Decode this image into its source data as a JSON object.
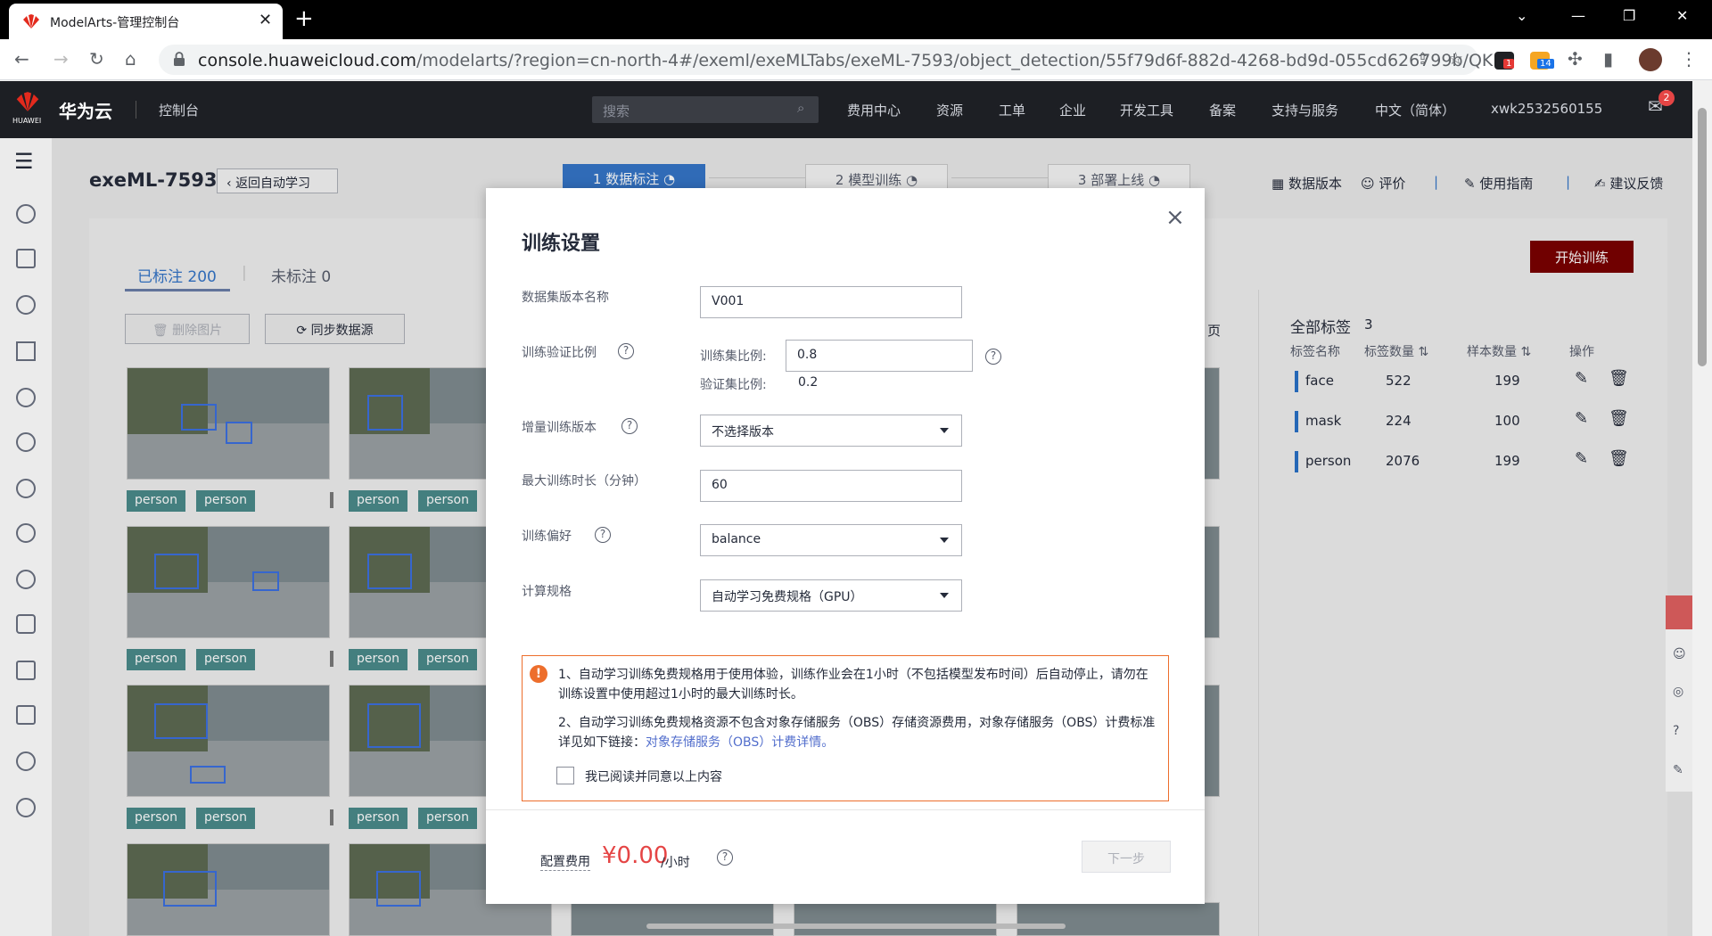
{
  "browser": {
    "tab_title": "ModelArts-管理控制台",
    "url_host": "console.huaweicloud.com",
    "url_rest": "/modelarts/?region=cn-north-4#/exeml/exeMLTabs/exeML-7593/object_detection/55f79d6f-882d-4268-bd9d-055cd626799b/QK...",
    "ext_badge_1": "1",
    "ext_badge_2": "14"
  },
  "header": {
    "brand": "华为云",
    "brand_sub": "HUAWEI",
    "console": "控制台",
    "search_placeholder": "搜索",
    "nav": [
      "费用中心",
      "资源",
      "工单",
      "企业",
      "开发工具",
      "备案",
      "支持与服务",
      "中文（简体）",
      "xwk2532560155"
    ],
    "mail_badge": "2"
  },
  "page": {
    "title": "exeML-7593",
    "back": "返回自动学习",
    "steps": [
      "1 数据标注",
      "2 模型训练",
      "3 部署上线"
    ],
    "tools": [
      "数据版本",
      "评价",
      "使用指南",
      "建议反馈"
    ],
    "start_train": "开始训练",
    "tab_labeled": "已标注 200",
    "tab_unlabeled": "未标注 0",
    "delete_images": "删除图片",
    "sync_source": "同步数据源",
    "page_fragment": "页",
    "tag": "person"
  },
  "labels": {
    "title": "全部标签",
    "count": "3",
    "cols": [
      "标签名称",
      "标签数量",
      "样本数量",
      "操作"
    ],
    "rows": [
      {
        "name": "face",
        "tag_count": "522",
        "sample_count": "199"
      },
      {
        "name": "mask",
        "tag_count": "224",
        "sample_count": "100"
      },
      {
        "name": "person",
        "tag_count": "2076",
        "sample_count": "199"
      }
    ]
  },
  "modal": {
    "title": "训练设置",
    "fields": {
      "dataset_version_label": "数据集版本名称",
      "dataset_version_value": "V001",
      "ratio_label": "训练验证比例",
      "train_ratio_label": "训练集比例:",
      "train_ratio_value": "0.8",
      "val_ratio_label": "验证集比例:",
      "val_ratio_value": "0.2",
      "incremental_label": "增量训练版本",
      "incremental_value": "不选择版本",
      "max_time_label": "最大训练时长（分钟）",
      "max_time_value": "60",
      "preference_label": "训练偏好",
      "preference_value": "balance",
      "spec_label": "计算规格",
      "spec_value": "自动学习免费规格（GPU）"
    },
    "notice": {
      "p1": "1、自动学习训练免费规格用于使用体验，训练作业会在1小时（不包括模型发布时间）后自动停止，请勿在训练设置中使用超过1小时的最大训练时长。",
      "p2_text": "2、自动学习训练免费规格资源不包含对象存储服务（OBS）存储资源费用，对象存储服务（OBS）计费标准详见如下链接：",
      "p2_link": "对象存储服务（OBS）计费详情。",
      "agree": "我已阅读并同意以上内容"
    },
    "fee_label": "配置费用",
    "fee_value": "¥0.00",
    "fee_unit": "/小时",
    "next": "下一步"
  }
}
